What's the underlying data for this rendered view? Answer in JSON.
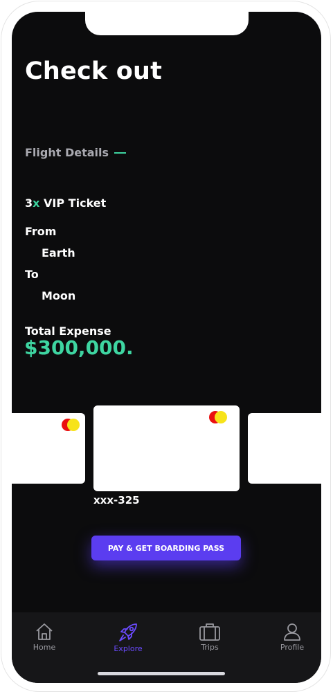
{
  "page": {
    "title": "Check out",
    "section_label": "Flight Details",
    "ticket": {
      "qty": "3",
      "x": "x",
      "label": "VIP Ticket"
    },
    "from_label": "From",
    "from_value": "Earth",
    "to_label": "To",
    "to_value": "Moon",
    "total_label": "Total Expense",
    "total_amount": "$300,000."
  },
  "cards": {
    "selected_number": "xxx-325"
  },
  "actions": {
    "pay_label": "PAY & GET BOARDING PASS"
  },
  "tabbar": {
    "items": [
      {
        "label": "Home",
        "icon": "home-icon",
        "active": false
      },
      {
        "label": "Explore",
        "icon": "rocket-icon",
        "active": true
      },
      {
        "label": "Trips",
        "icon": "suitcase-icon",
        "active": false
      },
      {
        "label": "Profile",
        "icon": "user-icon",
        "active": false
      }
    ]
  },
  "colors": {
    "background": "#0c0c0d",
    "accent_green": "#3ed5a1",
    "accent_purple": "#5b3df0",
    "tab_inactive": "#9a9aa0"
  }
}
